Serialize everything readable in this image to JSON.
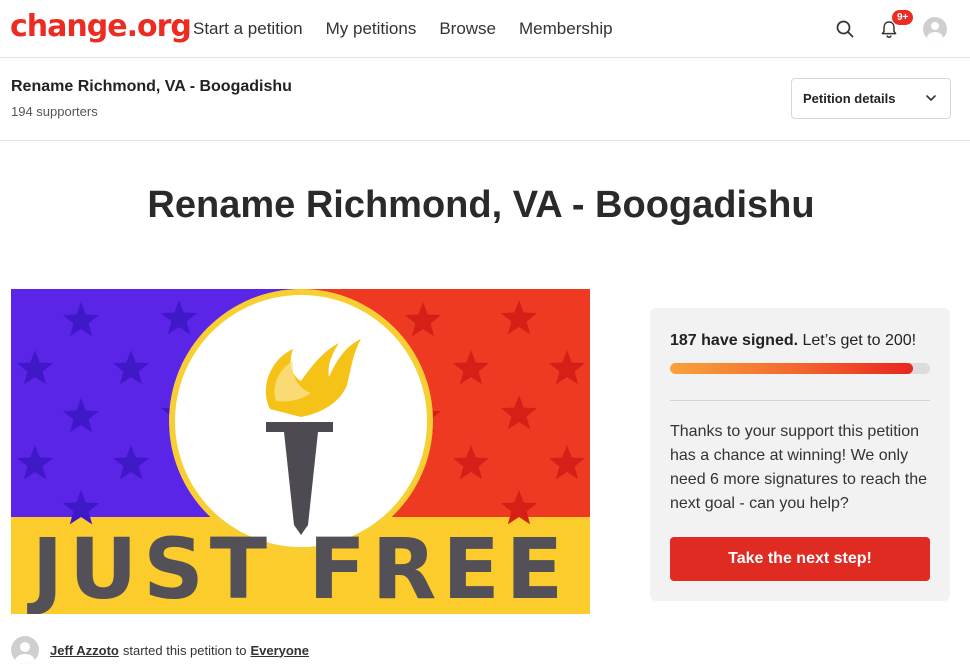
{
  "header": {
    "logo_text": "change.org",
    "nav": [
      "Start a petition",
      "My petitions",
      "Browse",
      "Membership"
    ],
    "notification_badge": "9+",
    "icons": {
      "search": "search-icon",
      "notifications": "bell-icon",
      "profile": "avatar"
    }
  },
  "subheader": {
    "title": "Rename Richmond, VA - Boogadishu",
    "supporters": "194 supporters",
    "details_button": "Petition details"
  },
  "petition": {
    "title": "Rename Richmond, VA - Boogadishu",
    "image": {
      "banner_text": "JUST FREE",
      "colors": {
        "left": "#5b25e8",
        "right": "#ee3a22",
        "bottom": "#fbcc2b",
        "text": "#535058",
        "torch_flame": "#f5c318",
        "torch_handle": "#4d4a52"
      }
    },
    "starter_name": "Jeff Azzoto",
    "starter_middle": "started this petition to",
    "starter_target": "Everyone"
  },
  "progress": {
    "signed_strong": "187 have signed.",
    "signed_rest": " Let’s get to 200!",
    "signed": 187,
    "goal": 200,
    "message": "Thanks to your support this petition has a chance at winning! We only need 6 more signatures to reach the next goal - can you help?",
    "cta": "Take the next step!"
  },
  "colors": {
    "brand": "#ec2c22",
    "cta": "#e02b23",
    "card_bg": "#f2f2f2"
  }
}
